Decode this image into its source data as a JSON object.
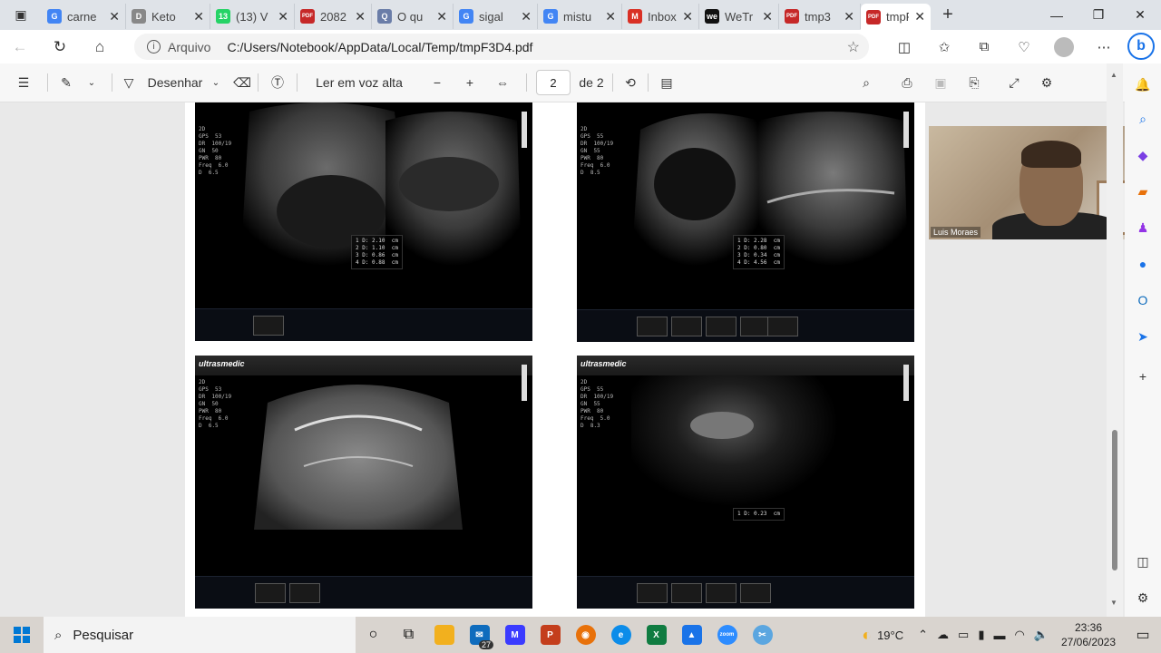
{
  "tabs": [
    {
      "label": "carne",
      "fav": "G",
      "color": "#4285f4"
    },
    {
      "label": "Keto",
      "fav": "D",
      "color": "#888888"
    },
    {
      "label": "(13) V",
      "fav": "13",
      "color": "#25d366"
    },
    {
      "label": "2082",
      "fav": "PDF",
      "color": "#c62828"
    },
    {
      "label": "O qu",
      "fav": "Q",
      "color": "#6a7da8"
    },
    {
      "label": "sigal",
      "fav": "G",
      "color": "#4285f4"
    },
    {
      "label": "mistu",
      "fav": "G",
      "color": "#4285f4"
    },
    {
      "label": "Inbox",
      "fav": "M",
      "color": "#d93025"
    },
    {
      "label": "WeTr",
      "fav": "we",
      "color": "#111111"
    },
    {
      "label": "tmp3",
      "fav": "PDF",
      "color": "#c62828"
    },
    {
      "label": "tmpF",
      "fav": "PDF",
      "color": "#c62828"
    }
  ],
  "address": {
    "origin_label": "Arquivo",
    "path": "C:/Users/Notebook/AppData/Local/Temp/tmpF3D4.pdf"
  },
  "pdf_toolbar": {
    "draw_label": "Desenhar",
    "read_aloud_label": "Ler em voz alta",
    "page_current": "2",
    "page_total": "de 2"
  },
  "images": [
    {
      "params": "2D\nGPS  53\nDR  100/19\nGN  50\nPWR  80\nFreq  6.0\nD  6.5",
      "meas": "1 D: 2.10  cm\n2 D: 1.10  cm\n3 D: 0.86  cm\n4 D: 0.88  cm"
    },
    {
      "params": "2D\nGPS  55\nDR  100/19\nGN  55\nPWR  80\nFreq  6.0\nD  8.5",
      "meas": "1 D: 2.28  cm\n2 D: 0.80  cm\n3 D: 0.34  cm\n4 D: 4.56  cm"
    },
    {
      "params": "2D\nGPS  53\nDR  100/19\nGN  50\nPWR  80\nFreq  6.0\nD  6.5",
      "meas": ""
    },
    {
      "params": "2D\nGPS  55\nDR  100/19\nGN  55\nPWR  80\nFreq  5.0\nD  8.3",
      "meas": "1 D: 0.23  cm"
    }
  ],
  "logo_text": "ultrasmedic",
  "video": {
    "name": "Luis Moraes"
  },
  "taskbar": {
    "search_label": "Pesquisar",
    "weather": "19°C",
    "time": "23:36",
    "date": "27/06/2023",
    "mail_badge": "27"
  }
}
